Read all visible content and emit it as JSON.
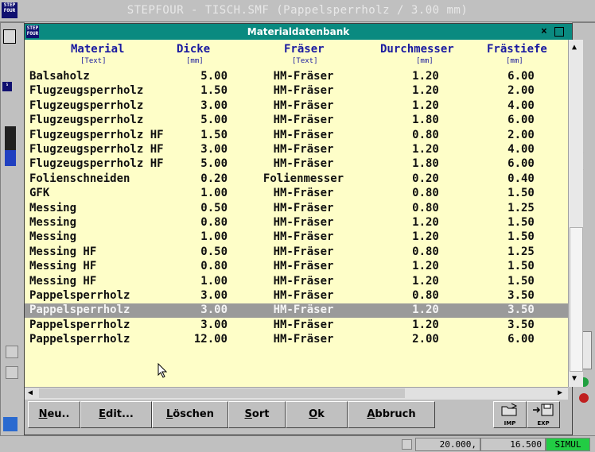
{
  "window": {
    "title": "STEPFOUR - TISCH.SMF (Pappelsperrholz / 3.00 mm)",
    "logo": "STEP\nFOUR"
  },
  "dialog": {
    "title": "Materialdatenbank",
    "columns": [
      {
        "label": "Material",
        "unit": "[Text]"
      },
      {
        "label": "Dicke",
        "unit": "[mm]"
      },
      {
        "label": "Fräser",
        "unit": "[Text]"
      },
      {
        "label": "Durchmesser",
        "unit": "[mm]"
      },
      {
        "label": "Frästiefe",
        "unit": "[mm]"
      }
    ],
    "rows": [
      [
        "Balsaholz",
        "5.00",
        "HM-Fräser",
        "1.20",
        "6.00"
      ],
      [
        "Flugzeugsperrholz",
        "1.50",
        "HM-Fräser",
        "1.20",
        "2.00"
      ],
      [
        "Flugzeugsperrholz",
        "3.00",
        "HM-Fräser",
        "1.20",
        "4.00"
      ],
      [
        "Flugzeugsperrholz",
        "5.00",
        "HM-Fräser",
        "1.80",
        "6.00"
      ],
      [
        "Flugzeugsperrholz HF",
        "1.50",
        "HM-Fräser",
        "0.80",
        "2.00"
      ],
      [
        "Flugzeugsperrholz HF",
        "3.00",
        "HM-Fräser",
        "1.20",
        "4.00"
      ],
      [
        "Flugzeugsperrholz HF",
        "5.00",
        "HM-Fräser",
        "1.80",
        "6.00"
      ],
      [
        "Folienschneiden",
        "0.20",
        "Folienmesser",
        "0.20",
        "0.40"
      ],
      [
        "GFK",
        "1.00",
        "HM-Fräser",
        "0.80",
        "1.50"
      ],
      [
        "Messing",
        "0.50",
        "HM-Fräser",
        "0.80",
        "1.25"
      ],
      [
        "Messing",
        "0.80",
        "HM-Fräser",
        "1.20",
        "1.50"
      ],
      [
        "Messing",
        "1.00",
        "HM-Fräser",
        "1.20",
        "1.50"
      ],
      [
        "Messing HF",
        "0.50",
        "HM-Fräser",
        "0.80",
        "1.25"
      ],
      [
        "Messing HF",
        "0.80",
        "HM-Fräser",
        "1.20",
        "1.50"
      ],
      [
        "Messing HF",
        "1.00",
        "HM-Fräser",
        "1.20",
        "1.50"
      ],
      [
        "Pappelsperrholz",
        "3.00",
        "HM-Fräser",
        "0.80",
        "3.50"
      ],
      [
        "Pappelsperrholz",
        "3.00",
        "HM-Fräser",
        "1.20",
        "3.50"
      ],
      [
        "Pappelsperrholz",
        "3.00",
        "HM-Fräser",
        "1.20",
        "3.50"
      ],
      [
        "Pappelsperrholz",
        "12.00",
        "HM-Fräser",
        "2.00",
        "6.00"
      ]
    ],
    "selected_row": 16,
    "buttons": [
      {
        "key": "N",
        "rest": "eu.."
      },
      {
        "key": "E",
        "rest": "dit..."
      },
      {
        "key": "L",
        "rest": "öschen"
      },
      {
        "key": "S",
        "rest": "ort"
      },
      {
        "key": "O",
        "rest": "k"
      },
      {
        "key": "A",
        "rest": "bbruch"
      }
    ],
    "import_label": "IMP",
    "export_label": "EXP"
  },
  "status": {
    "x": "20.000,",
    "y": "16.500",
    "mode": "SIMUL"
  },
  "colors": {
    "dialog_title": "#0a8a80",
    "grid_bg": "#fefec8",
    "selected": "#9a9a9a",
    "mode": "#22cc44"
  }
}
